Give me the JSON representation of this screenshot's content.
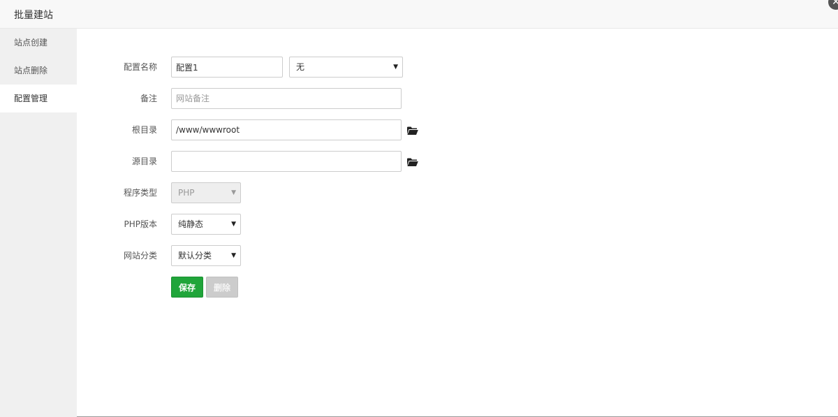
{
  "window": {
    "title": "批量建站",
    "close_symbol": "✕"
  },
  "sidebar": {
    "items": [
      {
        "label": "站点创建",
        "active": false
      },
      {
        "label": "站点删除",
        "active": false
      },
      {
        "label": "配置管理",
        "active": true
      }
    ]
  },
  "form": {
    "config_name": {
      "label": "配置名称",
      "value": "配置1",
      "select_value": "无"
    },
    "remark": {
      "label": "备注",
      "value": "",
      "placeholder": "网站备注"
    },
    "root_dir": {
      "label": "根目录",
      "value": "/www/wwwroot",
      "icon": "folder-open-icon"
    },
    "source_dir": {
      "label": "源目录",
      "value": "",
      "icon": "folder-open-icon"
    },
    "program_type": {
      "label": "程序类型",
      "value": "PHP",
      "disabled": true
    },
    "php_version": {
      "label": "PHP版本",
      "value": "纯静态"
    },
    "site_category": {
      "label": "网站分类",
      "value": "默认分类"
    },
    "save_label": "保存",
    "delete_label": "删除"
  },
  "colors": {
    "accent": "#20a53a",
    "sidebar_bg": "#f0f0f0",
    "disabled_button": "#cccccc"
  }
}
